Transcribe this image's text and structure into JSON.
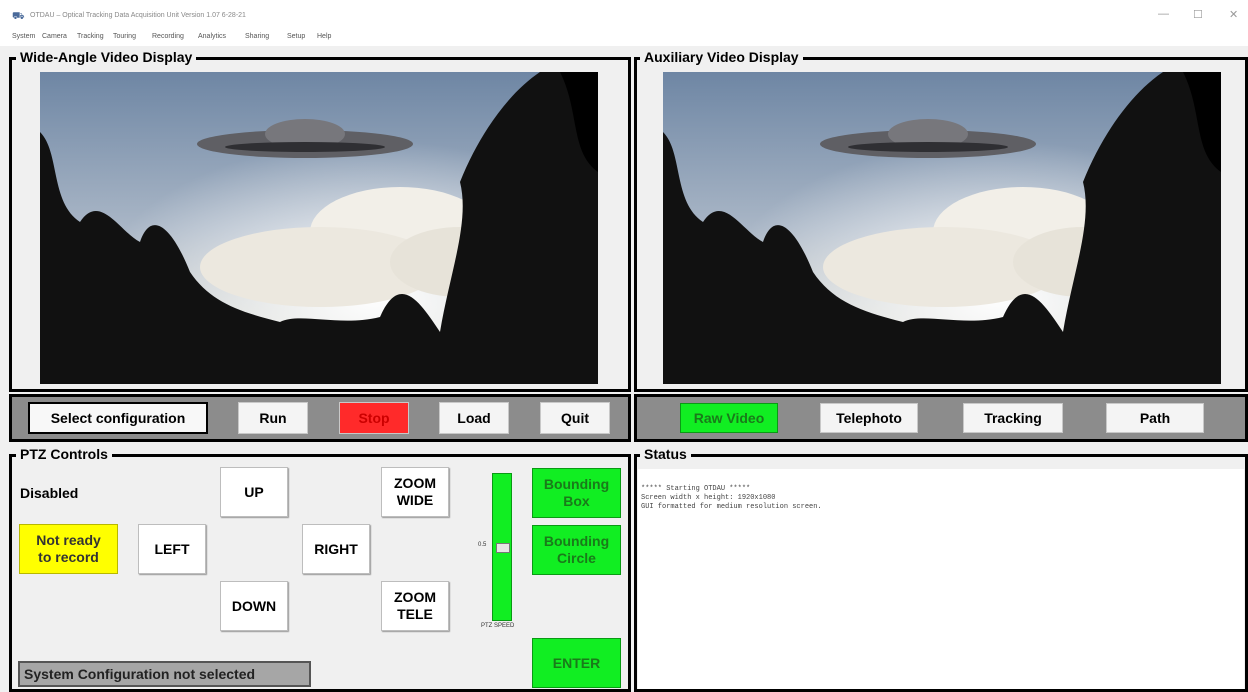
{
  "window": {
    "title": "OTDAU – Optical Tracking Data Acquisition Unit   Version 1.07 6-28-21",
    "minimize_icon": "minimize-icon",
    "maximize_icon": "maximize-icon",
    "close_icon": "close-icon"
  },
  "menu": [
    "System",
    "Camera",
    "Tracking",
    "Touring",
    "Recording",
    "Analytics",
    "Sharing",
    "Setup",
    "Help"
  ],
  "wide_angle": {
    "title": "Wide-Angle Video Display"
  },
  "auxiliary": {
    "title": "Auxiliary Video Display"
  },
  "controls_bar": {
    "select_config": "Select configuration",
    "run": "Run",
    "stop": "Stop",
    "load": "Load",
    "quit": "Quit"
  },
  "aux_bar": {
    "raw_video": "Raw Video",
    "telephoto": "Telephoto",
    "tracking": "Tracking",
    "path": "Path"
  },
  "ptz": {
    "title": "PTZ Controls",
    "state": "Disabled",
    "not_ready": "Not ready to record",
    "up": "UP",
    "down": "DOWN",
    "left": "LEFT",
    "right": "RIGHT",
    "zoom_wide": "ZOOM WIDE",
    "zoom_tele": "ZOOM TELE",
    "speed_value": "0.5",
    "speed_label": "PTZ SPEED",
    "speed_level": 0.5,
    "bounding_box": "Bounding Box",
    "bounding_circle": "Bounding Circle",
    "enter": "ENTER",
    "config_status": "System Configuration not selected"
  },
  "status": {
    "title": "Status",
    "lines": "***** Starting OTDAU *****\nScreen width x height: 1920x1080\nGUI formatted for medium resolution screen."
  },
  "colors": {
    "green": "#11ee22",
    "red": "#ff2a2a",
    "yellow": "#ffff00",
    "bar_gray": "#8c8c8c"
  }
}
